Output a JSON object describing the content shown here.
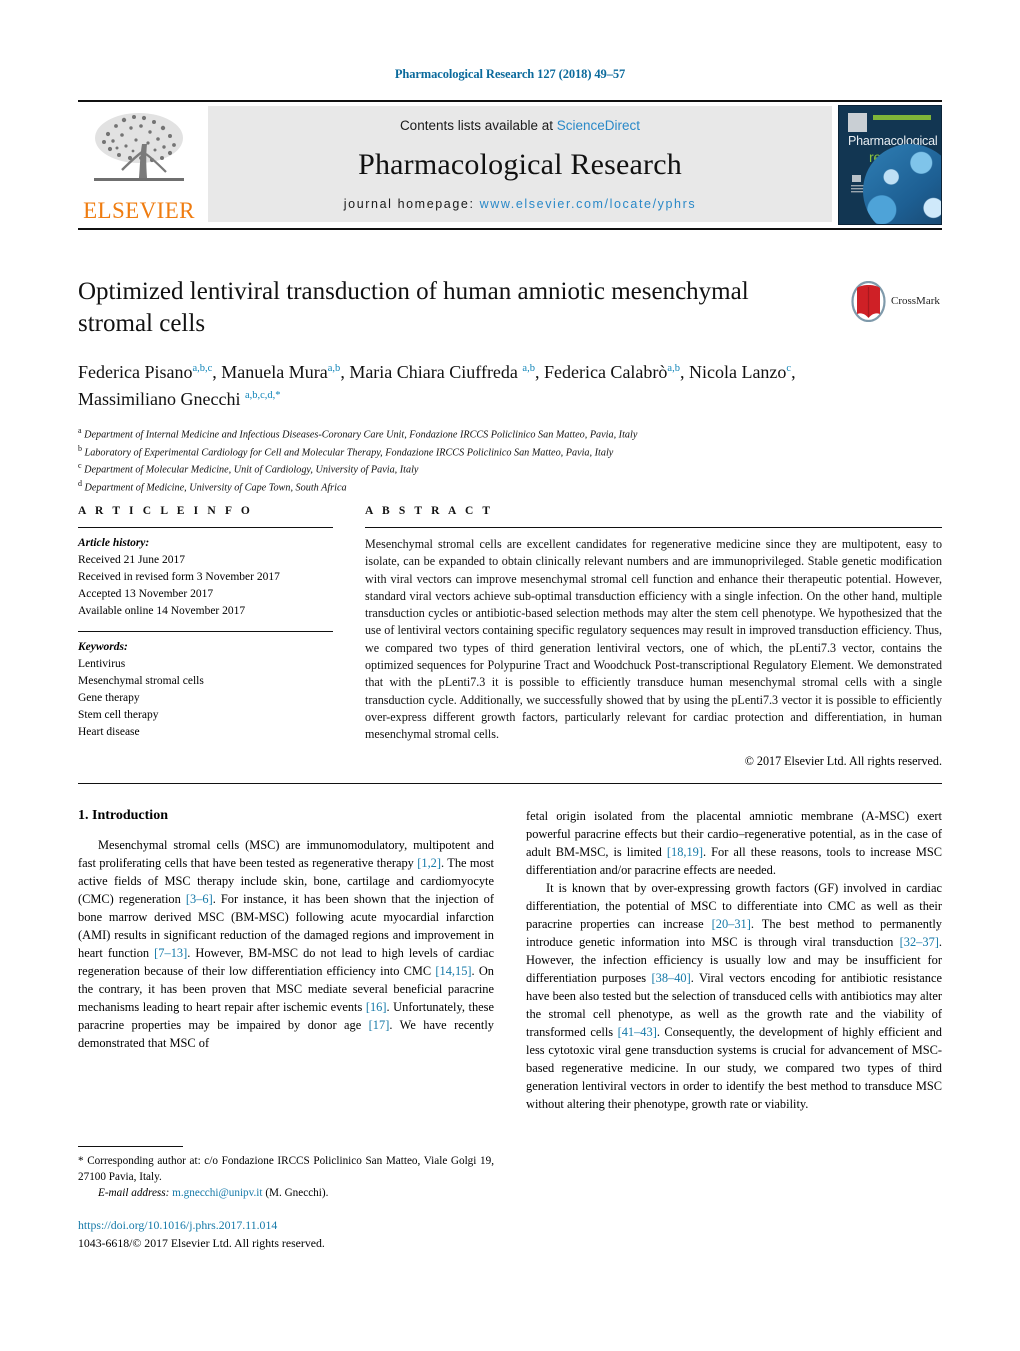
{
  "running_head": "Pharmacological Research 127 (2018) 49–57",
  "masthead": {
    "publisher_name": "ELSEVIER",
    "contents_prefix": "Contents lists available at ",
    "contents_link": "ScienceDirect",
    "journal_title": "Pharmacological Research",
    "homepage_prefix": "journal homepage: ",
    "homepage_url": "www.elsevier.com/locate/yphrs",
    "cover": {
      "line1": "Pharmacological",
      "line2": "research"
    }
  },
  "article": {
    "title": "Optimized lentiviral transduction of human amniotic mesenchymal stromal cells",
    "crossmark_label": "CrossMark",
    "authors_html": "Federica Pisano<sup>a,b,c</sup>, Manuela Mura<sup>a,b</sup>, Maria Chiara Ciuffreda <sup>a,b</sup>, Federica Calabrò<sup>a,b</sup>, Nicola Lanzo<sup>c</sup>, Massimiliano Gnecchi <sup>a,b,c,d,</sup><sup>*</sup>",
    "affiliations": [
      {
        "marker": "a",
        "text": "Department of Internal Medicine and Infectious Diseases-Coronary Care Unit, Fondazione IRCCS Policlinico San Matteo, Pavia, Italy"
      },
      {
        "marker": "b",
        "text": "Laboratory of Experimental Cardiology for Cell and Molecular Therapy, Fondazione IRCCS Policlinico San Matteo, Pavia, Italy"
      },
      {
        "marker": "c",
        "text": "Department of Molecular Medicine, Unit of Cardiology, University of Pavia, Italy"
      },
      {
        "marker": "d",
        "text": "Department of Medicine, University of Cape Town, South Africa"
      }
    ]
  },
  "article_info": {
    "heading": "A R T I C L E    I N F O",
    "history_label": "Article history:",
    "history": [
      "Received 21 June 2017",
      "Received in revised form 3 November 2017",
      "Accepted 13 November 2017",
      "Available online 14 November 2017"
    ],
    "keywords_label": "Keywords:",
    "keywords": [
      "Lentivirus",
      "Mesenchymal stromal cells",
      "Gene therapy",
      "Stem cell therapy",
      "Heart disease"
    ]
  },
  "abstract": {
    "heading": "A B S T R A C T",
    "text": "Mesenchymal stromal cells are excellent candidates for regenerative medicine since they are multipotent, easy to isolate, can be expanded to obtain clinically relevant numbers and are immunoprivileged. Stable genetic modification with viral vectors can improve mesenchymal stromal cell function and enhance their therapeutic potential. However, standard viral vectors achieve sub-optimal transduction efficiency with a single infection. On the other hand, multiple transduction cycles or antibiotic-based selection methods may alter the stem cell phenotype. We hypothesized that the use of lentiviral vectors containing specific regulatory sequences may result in improved transduction efficiency. Thus, we compared two types of third generation lentiviral vectors, one of which, the pLenti7.3 vector, contains the optimized sequences for Polypurine Tract and Woodchuck Post-transcriptional Regulatory Element. We demonstrated that with the pLenti7.3 it is possible to efficiently transduce human mesenchymal stromal cells with a single transduction cycle. Additionally, we successfully showed that by using the pLenti7.3 vector it is possible to efficiently over-express different growth factors, particularly relevant for cardiac protection and differentiation, in human mesenchymal stromal cells.",
    "copyright": "© 2017 Elsevier Ltd. All rights reserved."
  },
  "introduction": {
    "heading": "1. Introduction",
    "left_paragraph_html": "Mesenchymal stromal cells (MSC) are immunomodulatory, multipotent and fast proliferating cells that have been tested as regenerative therapy <span class=\"ref\">[1,2]</span>. The most active fields of MSC therapy include skin, bone, cartilage and cardiomyocyte (CMC) regeneration <span class=\"ref\">[3–6]</span>. For instance, it has been shown that the injection of bone marrow derived MSC (BM-MSC) following acute myocardial infarction (AMI) results in significant reduction of the damaged regions and improvement in heart function <span class=\"ref\">[7–13]</span>. However, BM-MSC do not lead to high levels of cardiac regeneration because of their low differentiation efficiency into CMC <span class=\"ref\">[14,15]</span>. On the contrary, it has been proven that MSC mediate several beneficial paracrine mechanisms leading to heart repair after ischemic events <span class=\"ref\">[16]</span>. Unfortunately, these paracrine properties may be impaired by donor age <span class=\"ref\">[17]</span>. We have recently demonstrated that MSC of",
    "right_paragraph_1_html": "fetal origin isolated from the placental amniotic membrane (A-MSC) exert powerful paracrine effects but their cardio–regenerative potential, as in the case of adult BM-MSC, is limited <span class=\"ref\">[18,19]</span>. For all these reasons, tools to increase MSC differentiation and/or paracrine effects are needed.",
    "right_paragraph_2_html": "It is known that by over-expressing growth factors (GF) involved in cardiac differentiation, the potential of MSC to differentiate into CMC as well as their paracrine properties can increase <span class=\"ref\">[20–31]</span>. The best method to permanently introduce genetic information into MSC is through viral transduction <span class=\"ref\">[32–37]</span>. However, the infection efficiency is usually low and may be insufficient for differentiation purposes <span class=\"ref\">[38–40]</span>. Viral vectors encoding for antibiotic resistance have been also tested but the selection of transduced cells with antibiotics may alter the stromal cell phenotype, as well as the growth rate and the viability of transformed cells <span class=\"ref\">[41–43]</span>. Consequently, the development of highly efficient and less cytotoxic viral gene transduction systems is crucial for advancement of MSC-based regenerative medicine. In our study, we compared two types of third generation lentiviral vectors in order to identify the best method to transduce MSC without altering their phenotype, growth rate or viability."
  },
  "footnote": {
    "corresponding_html": "<span class=\"star\">*</span> Corresponding author at: c/o Fondazione IRCCS Policlinico San Matteo, Viale Golgi 19, 27100 Pavia, Italy.",
    "email_label": "E-mail address:",
    "email": "m.gnecchi@unipv.it",
    "email_suffix": "(M. Gnecchi).",
    "doi": "https://doi.org/10.1016/j.phrs.2017.11.014",
    "issn_line": "1043-6618/© 2017 Elsevier Ltd. All rights reserved."
  },
  "colors": {
    "link": "#1579a8",
    "elsevier_orange": "#ef7c10",
    "cover_blue": "#123652",
    "cover_green": "#8cc63f"
  }
}
